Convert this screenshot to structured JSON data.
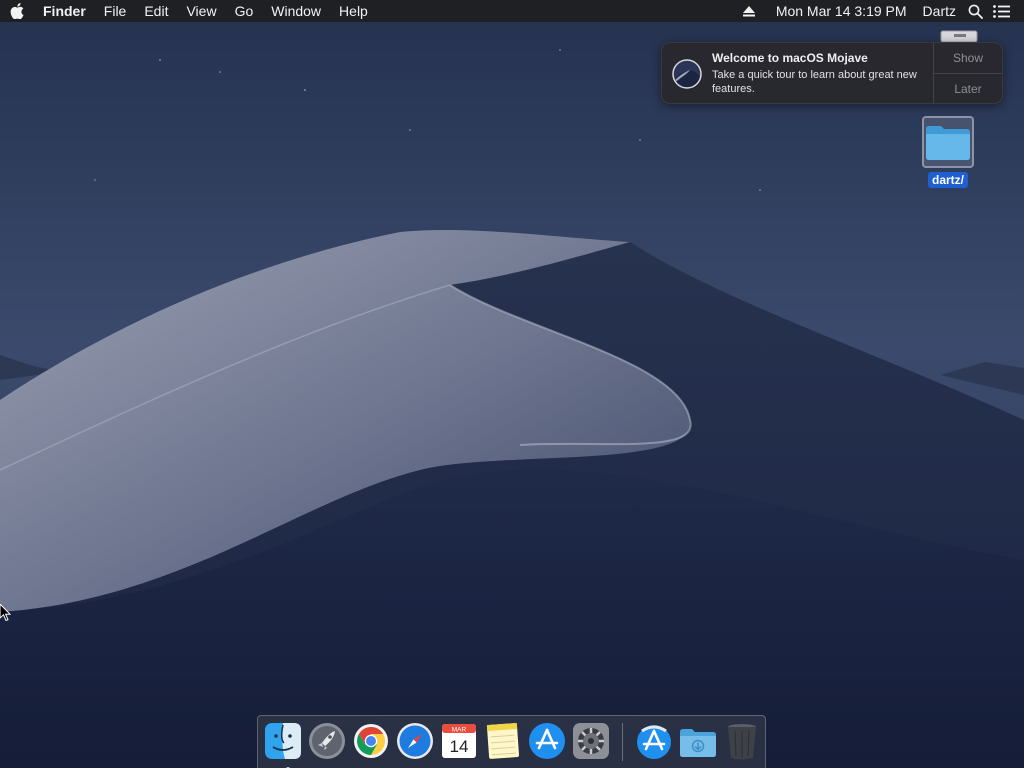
{
  "menubar": {
    "app_name": "Finder",
    "menus": [
      "File",
      "Edit",
      "View",
      "Go",
      "Window",
      "Help"
    ],
    "clock": "Mon Mar 14  3:19 PM",
    "user": "Dartz",
    "icons": [
      "apple-icon",
      "eject-icon",
      "spotlight-search-icon",
      "notification-center-icon"
    ]
  },
  "notification": {
    "title": "Welcome to macOS Mojave",
    "body": "Take a quick tour to learn about great new features.",
    "show_label": "Show",
    "later_label": "Later"
  },
  "desktop": {
    "folder_label": "dartz/"
  },
  "dock": {
    "apps": [
      "finder",
      "launchpad",
      "chrome",
      "safari",
      "calendar",
      "notes",
      "app-store",
      "system-preferences"
    ],
    "calendar_month": "MAR",
    "calendar_day": "14",
    "right_side": [
      "app-store-downloads",
      "downloads-folder",
      "trash"
    ]
  },
  "colors": {
    "menubar": "#1e1e20",
    "selection": "#1f5fd1",
    "sky": "#25335a"
  }
}
